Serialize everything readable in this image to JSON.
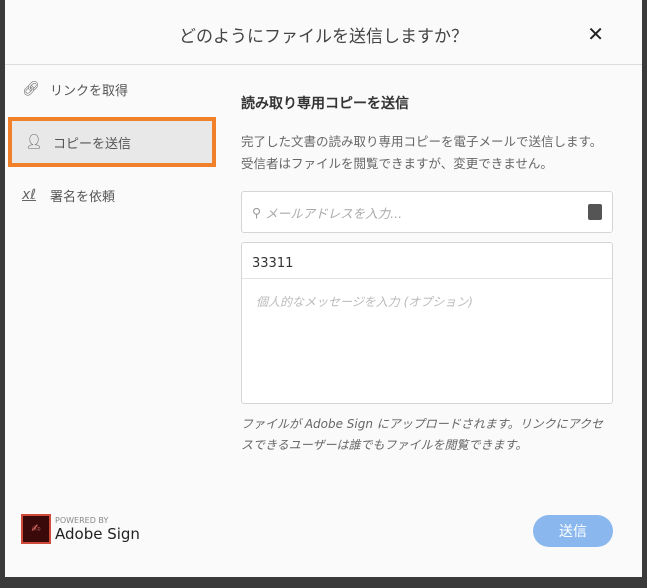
{
  "title": "どのようにファイルを送信しますか？",
  "nav": [
    {
      "label": "リンクを取得"
    },
    {
      "label": "コピーを送信"
    },
    {
      "label": "署名を依頼"
    }
  ],
  "main": {
    "heading": "読み取り専用コピーを送信",
    "description": "完了した文書の読み取り専用コピーを電子メールで送信します。受信者はファイルを閲覧できますが、変更できません。",
    "email_placeholder": "メールアドレスを入力...",
    "subject": "33311",
    "message_placeholder": "個人的なメッセージを入力 (オプション)",
    "note": "ファイルが Adobe Sign にアップロードされます。リンクにアクセスできるユーザーは誰でもファイルを閲覧できます。"
  },
  "footer": {
    "powered_by": "POWERED BY",
    "brand": "Adobe Sign",
    "send": "送信"
  }
}
